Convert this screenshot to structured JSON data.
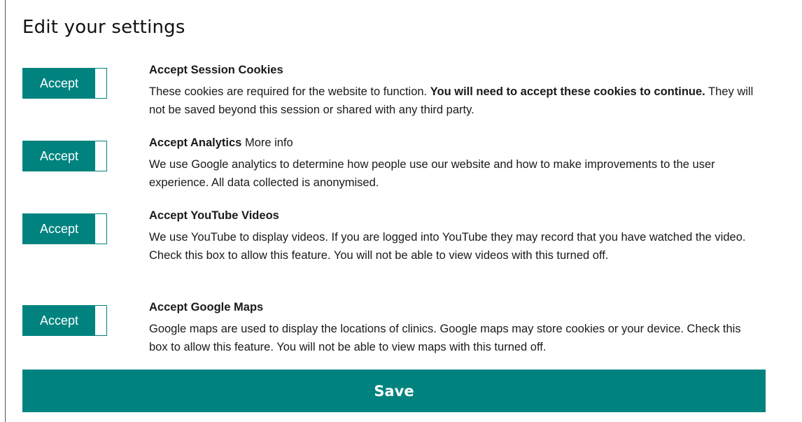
{
  "title": "Edit your settings",
  "settings": [
    {
      "toggle_label": "Accept",
      "heading": "Accept Session Cookies",
      "link": "",
      "desc_pre": "These cookies are required for the website to function. ",
      "desc_bold": "You will need to accept these cookies to continue.",
      "desc_post": " They will not be saved beyond this session or shared with any third party."
    },
    {
      "toggle_label": "Accept",
      "heading": "Accept Analytics",
      "link": "More info",
      "desc_pre": "We use Google analytics to determine how people use our website and how to make improvements to the user experience. All data collected is anonymised.",
      "desc_bold": "",
      "desc_post": ""
    },
    {
      "toggle_label": "Accept",
      "heading": "Accept YouTube Videos",
      "link": "",
      "desc_pre": "We use YouTube to display videos. If you are logged into YouTube they may record that you have watched the video. Check this box to allow this feature. You will not be able to view videos with this turned off.",
      "desc_bold": "",
      "desc_post": ""
    },
    {
      "toggle_label": "Accept",
      "heading": "Accept Google Maps",
      "link": "",
      "desc_pre": "Google maps are used to display the locations of clinics. Google maps may store cookies or your device. Check this box to allow this feature. You will not be able to view maps with this turned off.",
      "desc_bold": "",
      "desc_post": ""
    }
  ],
  "save_label": "Save",
  "colors": {
    "accent": "#00837f",
    "text": "#1a1a1a"
  }
}
